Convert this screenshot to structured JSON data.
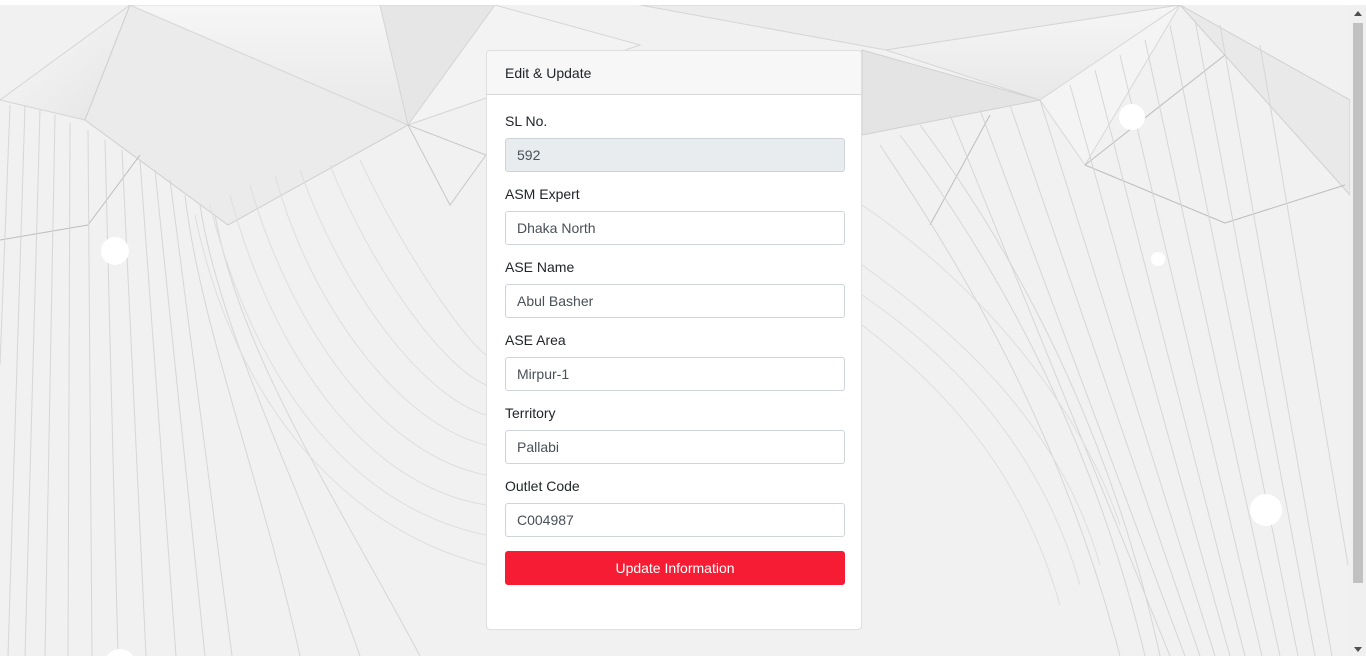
{
  "card": {
    "title": "Edit & Update"
  },
  "form": {
    "sl_no": {
      "label": "SL No.",
      "value": "592"
    },
    "asm_expert": {
      "label": "ASM Expert",
      "value": "Dhaka North"
    },
    "ase_name": {
      "label": "ASE Name",
      "value": "Abul Basher"
    },
    "ase_area": {
      "label": "ASE Area",
      "value": "Mirpur-1"
    },
    "territory": {
      "label": "Territory",
      "value": "Pallabi"
    },
    "outlet_code": {
      "label": "Outlet Code",
      "value": "C004987"
    },
    "submit_label": "Update Information"
  },
  "colors": {
    "accent": "#f51c33",
    "background": "#f1f1f1"
  }
}
